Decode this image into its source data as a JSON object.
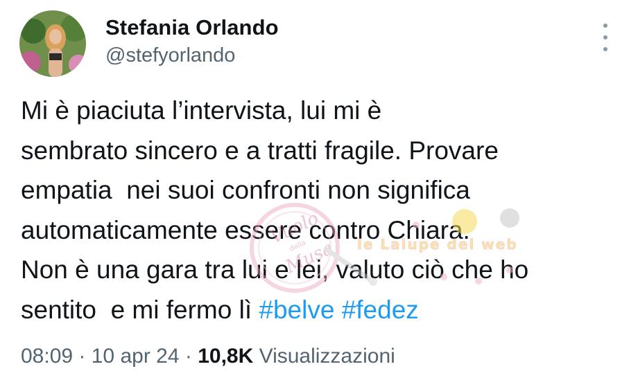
{
  "author": {
    "display_name": "Stefania Orlando",
    "handle": "@stefyorlando"
  },
  "more_icon": "more-vertical-icon",
  "tweet": {
    "lines": [
      "Mi è piaciuta l’intervista, lui mi è",
      "sembrato sincero e a tratti fragile. Provare",
      "empatia  nei suoi confronti non significa",
      "automaticamente essere contro Chiara.",
      "Non è una gara tra lui e lei, valuto ciò che ho"
    ],
    "last_line_text": "sentito  e mi fermo lì ",
    "hashtags": [
      "#belve",
      "#fedez"
    ]
  },
  "meta": {
    "time": "08:09",
    "separator": " · ",
    "date": "10 apr 24",
    "views_count": "10,8K",
    "views_label": " Visualizzazioni"
  },
  "watermark": {
    "stamp_text": "Vuolo dalla Musa",
    "banner_text": "le Laiupe del web"
  },
  "colors": {
    "hashtag": "#1d9bf0",
    "secondary_text": "#536471",
    "primary_text": "#0f1419"
  }
}
